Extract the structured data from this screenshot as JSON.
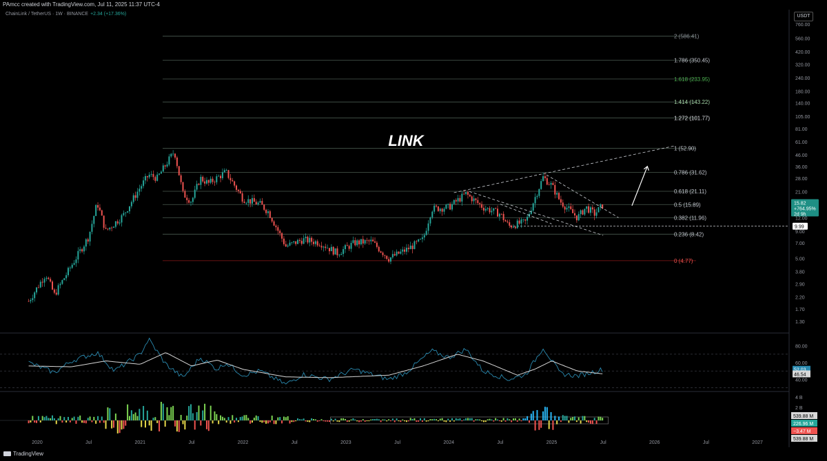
{
  "header": {
    "attribution": "PAmcc created with TradingView.com, Jul 11, 2025 11:37 UTC-4",
    "symbol_line": "ChainLink / TetherUS · 1W · BINANCE",
    "change": "+2.34 (+17.36%)",
    "currency_button": "USDT"
  },
  "footer": {
    "logo_text": "TradingView"
  },
  "colors": {
    "bg": "#000000",
    "up": "#26a69a",
    "down": "#ef5350",
    "fib": "#4d5b52",
    "fib_green": "#4caf50",
    "fib_zero": "#c62828",
    "rsi": "#2a8ab0",
    "rsi_ma": "#d8d8d8"
  },
  "chart_data": [
    {
      "type": "candlestick",
      "title": "LINK",
      "scale": "log",
      "ylim": [
        1.1,
        900
      ],
      "x_ticks": [
        "2020",
        "Jul",
        "2021",
        "Jul",
        "2022",
        "Jul",
        "2023",
        "Jul",
        "2024",
        "Jul",
        "2025",
        "Jul",
        "2026",
        "Jul",
        "2027"
      ],
      "y_ticks": [
        760.0,
        560.0,
        420.0,
        320.0,
        240.0,
        180.0,
        140.0,
        105.0,
        81.0,
        61.0,
        46.0,
        36.0,
        28.0,
        21.0,
        15.0,
        12.0,
        9.0,
        7.0,
        5.0,
        3.8,
        2.9,
        2.2,
        1.7,
        1.3
      ],
      "y_tick_labels": [
        "760.00",
        "560.00",
        "420.00",
        "320.00",
        "240.00",
        "180.00",
        "140.00",
        "105.00",
        "81.00",
        "61.00",
        "46.00",
        "36.00",
        "28.00",
        "21.00",
        "15.00",
        "12.00",
        "9.00",
        "7.00",
        "5.00",
        "3.80",
        "2.90",
        "2.20",
        "1.70",
        "1.30"
      ],
      "fib_levels": [
        {
          "label": "2 (586.41)",
          "value": 586.41,
          "color": "#8a8f96"
        },
        {
          "label": "1.786 (350.45)",
          "value": 350.45,
          "color": "#c0c4cc"
        },
        {
          "label": "1.618 (233.95)",
          "value": 233.95,
          "color": "#4caf50"
        },
        {
          "label": "1.414 (143.22)",
          "value": 143.22,
          "color": "#a5d6a7"
        },
        {
          "label": "1.272 (101.77)",
          "value": 101.77,
          "color": "#e0e3e8"
        },
        {
          "label": "1 (52.90)",
          "value": 52.9,
          "color": "#c0c4cc"
        },
        {
          "label": "0.786 (31.62)",
          "value": 31.62,
          "color": "#c0c4cc"
        },
        {
          "label": "0.618 (21.11)",
          "value": 21.11,
          "color": "#c0c4cc"
        },
        {
          "label": "0.5 (15.89)",
          "value": 15.89,
          "color": "#c0c4cc"
        },
        {
          "label": "0.382 (11.96)",
          "value": 11.96,
          "color": "#c0c4cc"
        },
        {
          "label": "0.236 (8.42)",
          "value": 8.42,
          "color": "#c0c4cc"
        },
        {
          "label": "0 (4.77)",
          "value": 4.77,
          "color": "#ef5350"
        }
      ],
      "price_path": [
        {
          "x": "2019-12",
          "y": 2.0
        },
        {
          "x": "2020-02",
          "y": 3.6
        },
        {
          "x": "2020-03",
          "y": 2.3
        },
        {
          "x": "2020-05",
          "y": 4.3
        },
        {
          "x": "2020-07",
          "y": 8.0
        },
        {
          "x": "2020-08",
          "y": 16.5
        },
        {
          "x": "2020-09",
          "y": 9.0
        },
        {
          "x": "2020-11",
          "y": 12.5
        },
        {
          "x": "2021-01",
          "y": 23.0
        },
        {
          "x": "2021-02",
          "y": 30.0
        },
        {
          "x": "2021-03",
          "y": 28.0
        },
        {
          "x": "2021-05",
          "y": 50.0
        },
        {
          "x": "2021-06",
          "y": 20.0
        },
        {
          "x": "2021-07",
          "y": 17.0
        },
        {
          "x": "2021-08",
          "y": 28.0
        },
        {
          "x": "2021-09",
          "y": 25.0
        },
        {
          "x": "2021-11",
          "y": 32.0
        },
        {
          "x": "2022-01",
          "y": 18.0
        },
        {
          "x": "2022-03",
          "y": 16.0
        },
        {
          "x": "2022-04",
          "y": 13.5
        },
        {
          "x": "2022-06",
          "y": 6.5
        },
        {
          "x": "2022-08",
          "y": 7.5
        },
        {
          "x": "2022-10",
          "y": 7.0
        },
        {
          "x": "2022-12",
          "y": 5.6
        },
        {
          "x": "2023-02",
          "y": 7.0
        },
        {
          "x": "2023-04",
          "y": 7.2
        },
        {
          "x": "2023-06",
          "y": 5.0
        },
        {
          "x": "2023-08",
          "y": 6.0
        },
        {
          "x": "2023-10",
          "y": 7.5
        },
        {
          "x": "2023-11",
          "y": 14.5
        },
        {
          "x": "2024-01",
          "y": 15.0
        },
        {
          "x": "2024-03",
          "y": 20.0
        },
        {
          "x": "2024-05",
          "y": 15.0
        },
        {
          "x": "2024-07",
          "y": 13.0
        },
        {
          "x": "2024-08",
          "y": 10.0
        },
        {
          "x": "2024-10",
          "y": 11.0
        },
        {
          "x": "2024-11",
          "y": 18.0
        },
        {
          "x": "2024-12",
          "y": 28.5
        },
        {
          "x": "2025-01",
          "y": 24.0
        },
        {
          "x": "2025-02",
          "y": 17.0
        },
        {
          "x": "2025-04",
          "y": 12.0
        },
        {
          "x": "2025-05",
          "y": 15.0
        },
        {
          "x": "2025-06",
          "y": 13.0
        },
        {
          "x": "2025-07",
          "y": 15.82
        }
      ],
      "price_badges": [
        {
          "label": "15.82",
          "sublabel": "+764.95%",
          "sublabel2": "2d 9h",
          "value": 15.82,
          "color": "#26a69a"
        },
        {
          "label": "9.99",
          "value": 9.99,
          "color": "#ffffff"
        }
      ],
      "dashed_level": 9.99,
      "annotations": [
        "LINK"
      ]
    },
    {
      "type": "line",
      "title": "RSI",
      "ylim": [
        28,
        92
      ],
      "y_ticks": [
        80.0,
        60.0,
        40.0
      ],
      "y_tick_labels": [
        "80.00",
        "60.00",
        "40.00"
      ],
      "bands": [
        70,
        50,
        30
      ],
      "series": [
        {
          "values": [
            {
              "x": "2019-12",
              "y": 60
            },
            {
              "x": "2020-03",
              "y": 48
            },
            {
              "x": "2020-05",
              "y": 62
            },
            {
              "x": "2020-08",
              "y": 72
            },
            {
              "x": "2020-10",
              "y": 50
            },
            {
              "x": "2021-01",
              "y": 70
            },
            {
              "x": "2021-02",
              "y": 88
            },
            {
              "x": "2021-04",
              "y": 58
            },
            {
              "x": "2021-06",
              "y": 42
            },
            {
              "x": "2021-08",
              "y": 66
            },
            {
              "x": "2021-10",
              "y": 52
            },
            {
              "x": "2021-11",
              "y": 60
            },
            {
              "x": "2022-01",
              "y": 45
            },
            {
              "x": "2022-03",
              "y": 50
            },
            {
              "x": "2022-06",
              "y": 34
            },
            {
              "x": "2022-08",
              "y": 46
            },
            {
              "x": "2022-11",
              "y": 40
            },
            {
              "x": "2023-02",
              "y": 52
            },
            {
              "x": "2023-06",
              "y": 40
            },
            {
              "x": "2023-08",
              "y": 48
            },
            {
              "x": "2023-11",
              "y": 74
            },
            {
              "x": "2024-01",
              "y": 66
            },
            {
              "x": "2024-03",
              "y": 76
            },
            {
              "x": "2024-05",
              "y": 50
            },
            {
              "x": "2024-08",
              "y": 40
            },
            {
              "x": "2024-10",
              "y": 46
            },
            {
              "x": "2024-12",
              "y": 78
            },
            {
              "x": "2025-02",
              "y": 47
            },
            {
              "x": "2025-04",
              "y": 44
            },
            {
              "x": "2025-07",
              "y": 52.03
            }
          ]
        },
        {
          "values": [
            {
              "x": "2019-12",
              "y": 56
            },
            {
              "x": "2020-05",
              "y": 55
            },
            {
              "x": "2020-09",
              "y": 62
            },
            {
              "x": "2021-01",
              "y": 58
            },
            {
              "x": "2021-04",
              "y": 72
            },
            {
              "x": "2021-07",
              "y": 56
            },
            {
              "x": "2021-10",
              "y": 63
            },
            {
              "x": "2022-01",
              "y": 52
            },
            {
              "x": "2022-06",
              "y": 43
            },
            {
              "x": "2022-11",
              "y": 42
            },
            {
              "x": "2023-06",
              "y": 45
            },
            {
              "x": "2023-10",
              "y": 56
            },
            {
              "x": "2024-02",
              "y": 70
            },
            {
              "x": "2024-05",
              "y": 62
            },
            {
              "x": "2024-09",
              "y": 45
            },
            {
              "x": "2024-11",
              "y": 52
            },
            {
              "x": "2025-01",
              "y": 62
            },
            {
              "x": "2025-04",
              "y": 50
            },
            {
              "x": "2025-07",
              "y": 46.54
            }
          ]
        }
      ],
      "value_badges": [
        {
          "label": "52.03",
          "value": 52.03,
          "color": "#2a8ab0"
        },
        {
          "label": "46.54",
          "value": 46.54,
          "color": "#d8d8d8"
        }
      ]
    },
    {
      "type": "bar",
      "title": "Volume oscillator",
      "y_ticks": [
        "4 B",
        "2 B"
      ],
      "value_badges": [
        {
          "label": "539.88 M",
          "color": "#d8d8d8"
        },
        {
          "label": "226.96 M",
          "color": "#26a69a"
        },
        {
          "label": "−3.47 M",
          "color": "#ef5350"
        },
        {
          "label": "539.88 M",
          "color": "#d8d8d8"
        }
      ]
    }
  ]
}
